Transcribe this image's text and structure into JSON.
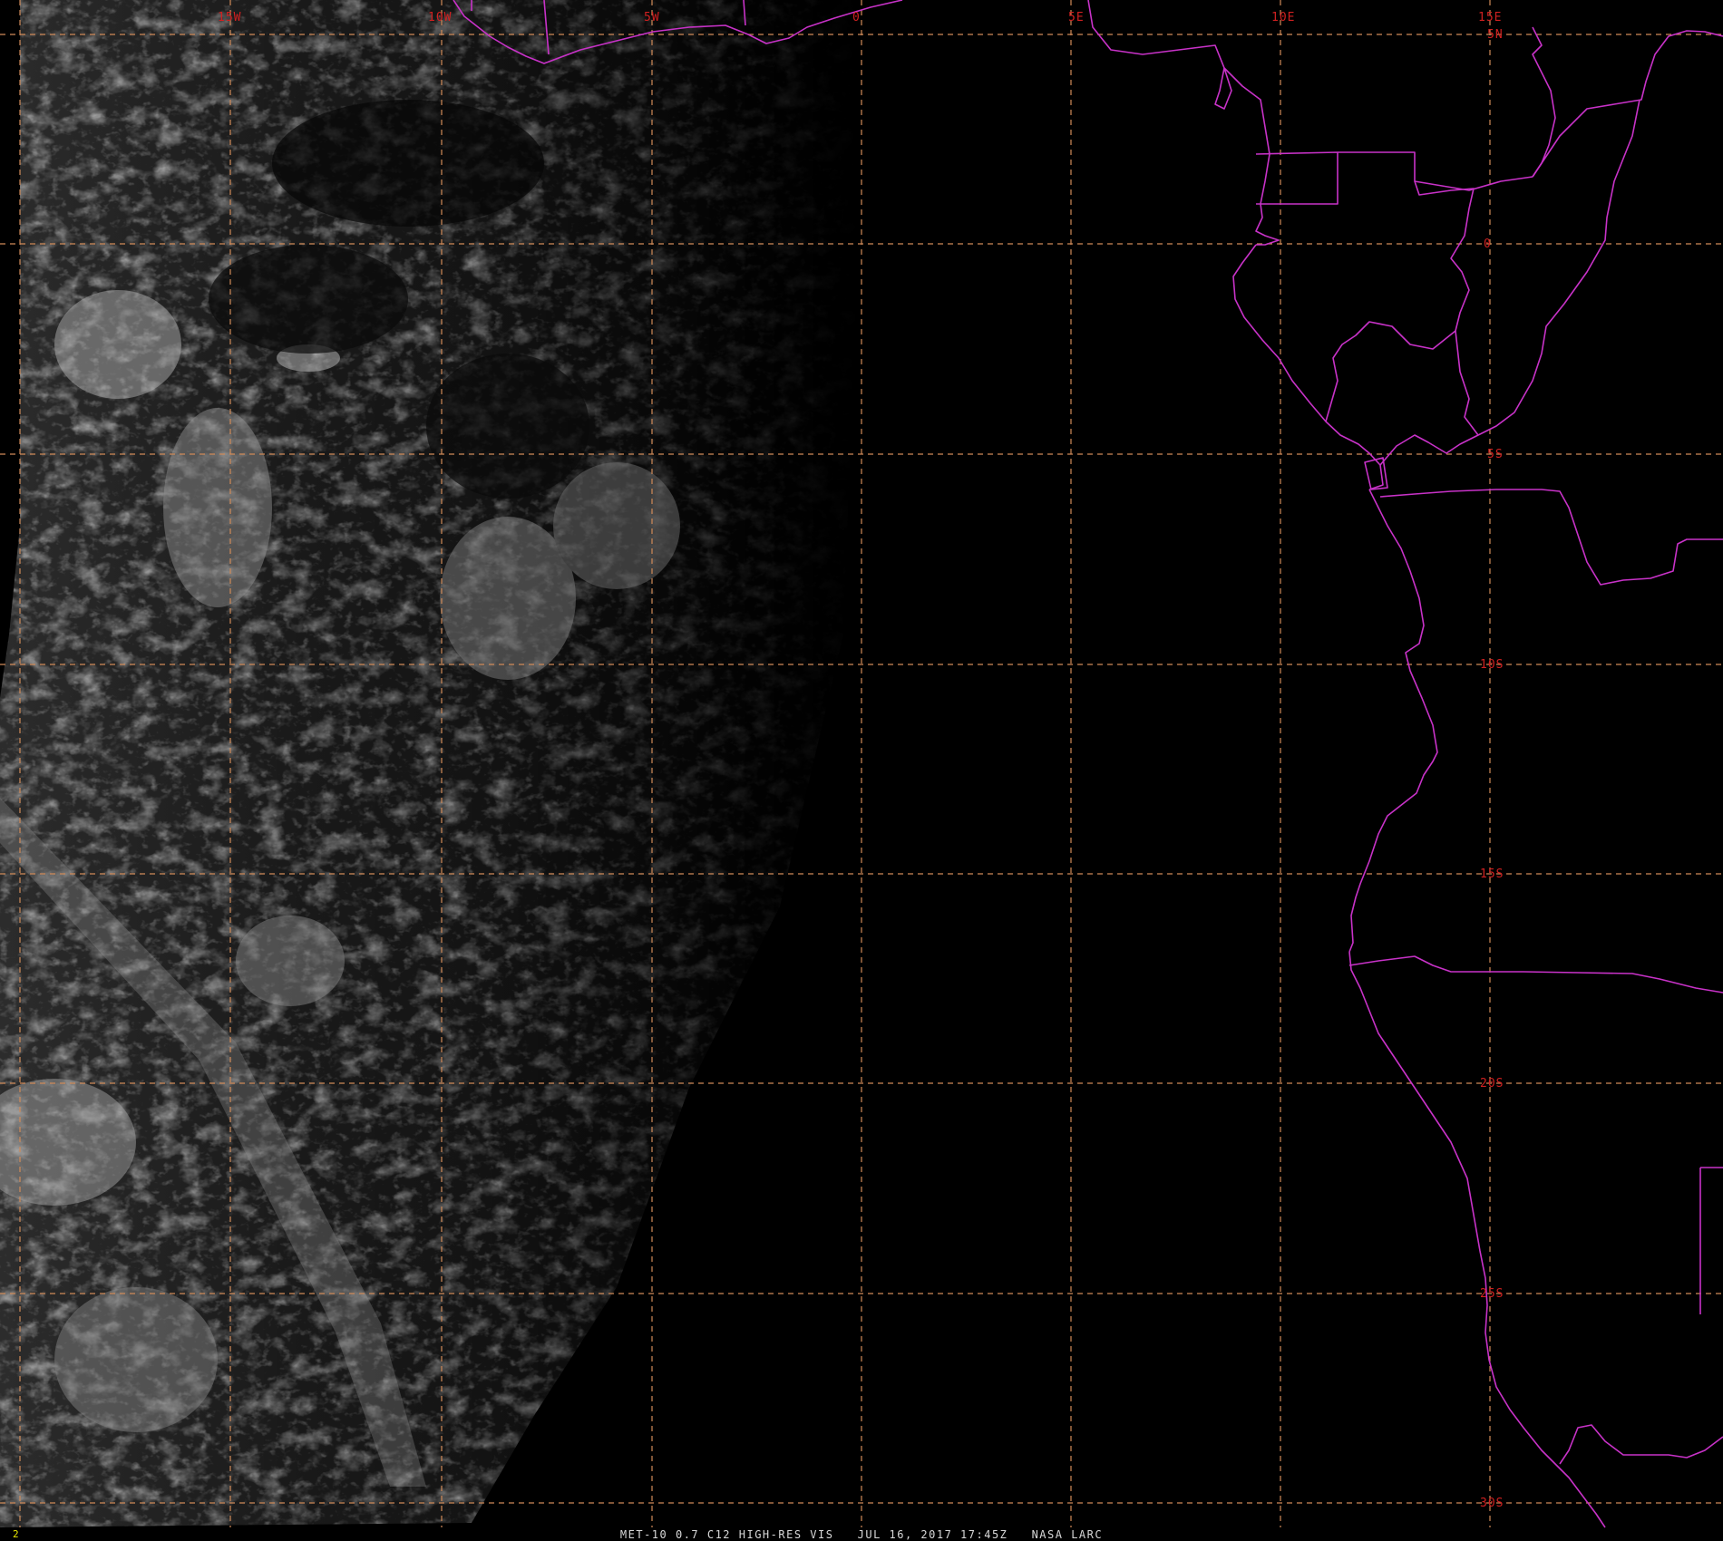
{
  "image": {
    "frame_number": "2",
    "caption": "MET-10 0.7 C12 HIGH-RES VIS   JUL 16, 2017 17:45Z   NASA LARC"
  },
  "grid": {
    "longitude_labels": [
      "15W",
      "10W",
      "5W",
      "0",
      "5E",
      "10E",
      "15E"
    ],
    "latitude_labels": [
      "5N",
      "0",
      "5S",
      "10S",
      "15S",
      "20S",
      "25S",
      "30S"
    ]
  },
  "colors": {
    "background": "#000000",
    "graticule": "#d08a58",
    "grid_labels": "#d02020",
    "borders": "#c832c8",
    "frame_number": "#e8e800",
    "caption": "#d8d8d8"
  },
  "icons": [
    "satellite-cloud-imagery",
    "country-border-lines",
    "lat-lon-graticule"
  ]
}
